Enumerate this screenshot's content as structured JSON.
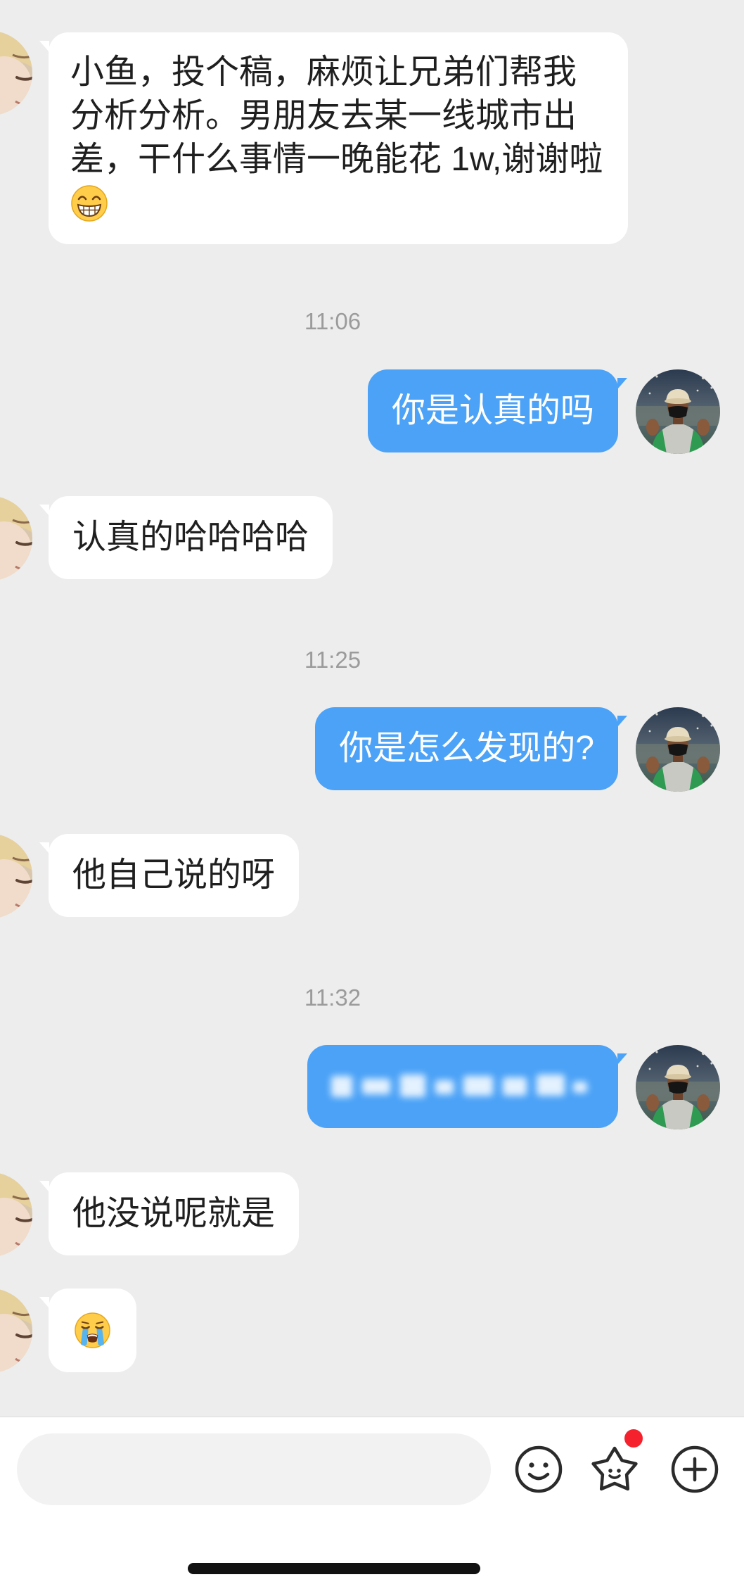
{
  "colors": {
    "chat_background": "#ededed",
    "incoming_bubble": "#ffffff",
    "outgoing_bubble": "#4ba2f7",
    "incoming_text": "#1f1f1f",
    "outgoing_text": "#ffffff",
    "timestamp_text": "#9b9b9b",
    "notification_dot": "#f5222d",
    "input_bar": "#ffffff",
    "input_field": "#f2f2f2",
    "icon": "#2b2b2b"
  },
  "chat": {
    "messages": [
      {
        "outgoing": false,
        "lines": [
          "小鱼，投个稿，麻烦让兄弟们帮我",
          "分析分析。男朋友去某一线城市出",
          "差，干什么事情一晚能花 1w,谢谢啦"
        ],
        "emoji": "beaming-face-emoji"
      },
      {
        "outgoing": true,
        "text": "你是认真的吗"
      },
      {
        "outgoing": false,
        "text": "认真的哈哈哈哈"
      },
      {
        "outgoing": true,
        "text": "你是怎么发现的?"
      },
      {
        "outgoing": false,
        "text": "他自己说的呀"
      },
      {
        "outgoing": true,
        "blurred": true
      },
      {
        "outgoing": false,
        "text": "他没说呢就是"
      },
      {
        "outgoing": false,
        "emoji": "loudly-crying-face-emoji"
      }
    ],
    "timestamps": [
      "11:06",
      "11:25",
      "11:32"
    ],
    "avatars": {
      "contact": "contact-avatar-photo",
      "me": "my-avatar-photo"
    }
  },
  "input_bar": {
    "message_input_value": "",
    "icons": [
      "smiley-icon",
      "star-face-icon",
      "plus-circle-icon"
    ],
    "star_notification_dot": true
  }
}
